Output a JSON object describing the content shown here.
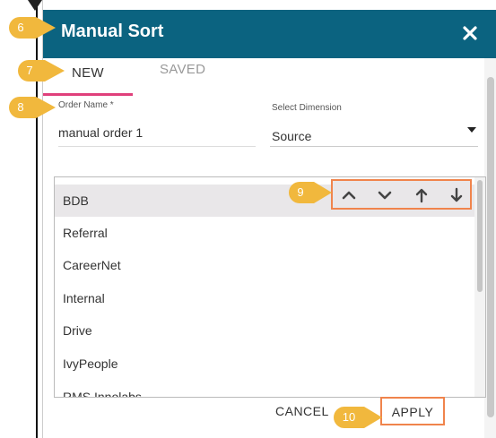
{
  "dialog": {
    "title": "Manual Sort",
    "close_icon": "close-icon"
  },
  "tabs": [
    {
      "label": "NEW",
      "active": true
    },
    {
      "label": "SAVED",
      "active": false
    }
  ],
  "form": {
    "order_name_label": "Order Name *",
    "order_name_value": "manual order 1",
    "dimension_label": "Select Dimension",
    "dimension_value": "Source"
  },
  "list": {
    "items": [
      "BDB",
      "Referral",
      "CareerNet",
      "Internal",
      "Drive",
      "IvyPeople",
      "RMS Innolabs"
    ],
    "selected_index": 0
  },
  "move_controls": {
    "icons": [
      "chevron-up-icon",
      "chevron-down-icon",
      "arrow-up-icon",
      "arrow-down-icon"
    ]
  },
  "footer": {
    "cancel_label": "CANCEL",
    "apply_label": "APPLY"
  },
  "callouts": {
    "c6": "6",
    "c7": "7",
    "c8": "8",
    "c9": "9",
    "c10": "10"
  },
  "colors": {
    "header": "#0b6380",
    "tab_indicator": "#e0407b",
    "callout": "#f1b83d",
    "highlight_border": "#f0844c"
  }
}
